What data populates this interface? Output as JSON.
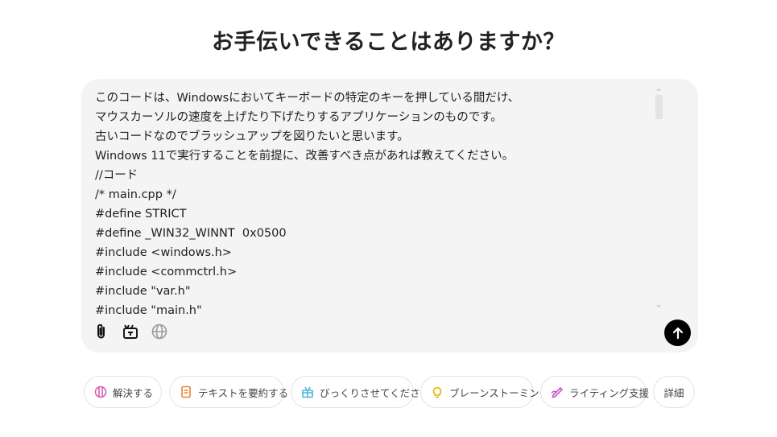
{
  "heading": "お手伝いできることはありますか？",
  "prompt": {
    "lines": [
      "このコードは、Windowsにおいてキーボードの特定のキーを押している間だけ、",
      "マウスカーソルの速度を上げたり下げたりするアプリケーションのものです。",
      "古いコードなのでブラッシュアップを図りたいと思います。",
      "Windows 11で実行することを前提に、改善すべき点があれば教えてください。",
      "//コード",
      "/* main.cpp */",
      "#define STRICT",
      "#define _WIN32_WINNT  0x0500",
      "#include <windows.h>",
      "#include <commctrl.h>",
      "#include \"var.h\"",
      "#include \"main.h\""
    ]
  },
  "toolbar": {
    "attach_icon": "paperclip-icon",
    "tools_icon": "toolbox-icon",
    "web_icon": "globe-icon",
    "send_icon": "arrow-up-icon"
  },
  "chips": [
    {
      "label": "解決する",
      "icon": "solve-icon",
      "color": "#d65db1"
    },
    {
      "label": "テキストを要約する",
      "icon": "document-icon",
      "color": "#e8823a"
    },
    {
      "label": "びっくりさせてください",
      "icon": "gift-icon",
      "color": "#4bb6d8"
    },
    {
      "label": "ブレーンストーミング",
      "icon": "lightbulb-icon",
      "color": "#e5b800"
    },
    {
      "label": "ライティング支援",
      "icon": "pen-icon",
      "color": "#c455c9"
    },
    {
      "label": "詳細",
      "icon": "",
      "color": "#444444"
    }
  ],
  "colors": {
    "composer_bg": "#f4f4f4",
    "send_bg": "#000000"
  }
}
